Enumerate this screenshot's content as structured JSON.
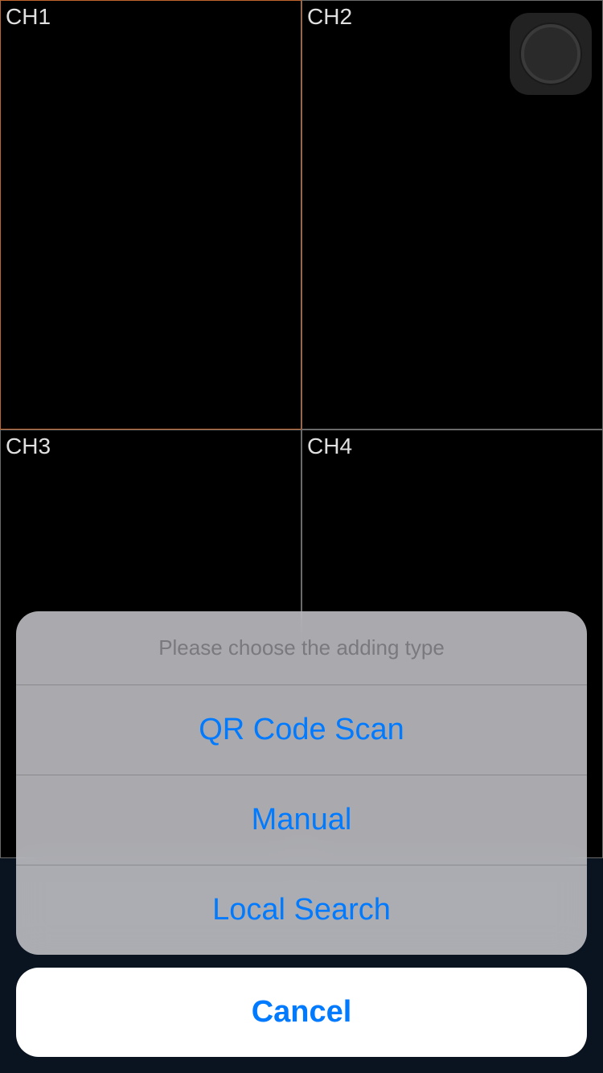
{
  "channels": [
    {
      "label": "CH1",
      "selected": true
    },
    {
      "label": "CH2",
      "selected": false
    },
    {
      "label": "CH3",
      "selected": false
    },
    {
      "label": "CH4",
      "selected": false
    }
  ],
  "action_sheet": {
    "title": "Please choose the adding type",
    "options": [
      "QR Code Scan",
      "Manual",
      "Local Search"
    ],
    "cancel": "Cancel"
  }
}
